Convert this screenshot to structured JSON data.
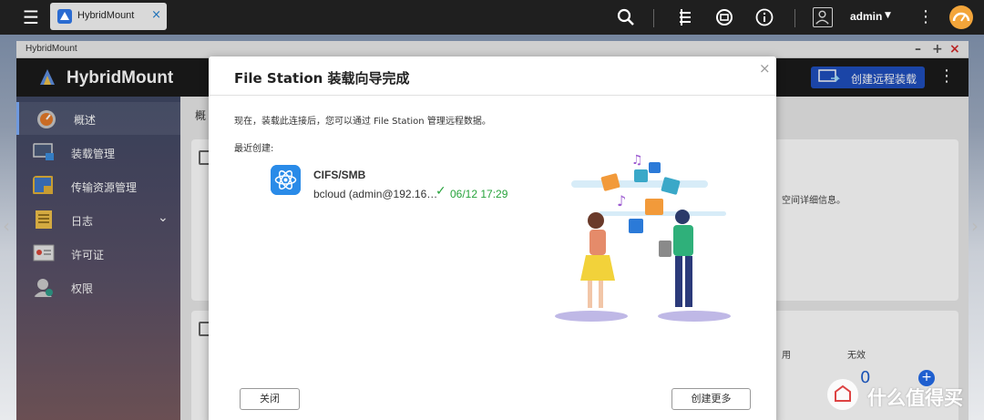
{
  "taskbar": {
    "tab_label": "HybridMount",
    "tab_close": "×",
    "user": "admin",
    "menu_icon": "hamburger-icon",
    "icons": [
      "search-icon",
      "stack-icon",
      "sync-icon",
      "info-icon",
      "user-icon",
      "more-icon",
      "gauge-icon"
    ]
  },
  "window": {
    "title": "HybridMount",
    "controls": {
      "minimize": "–",
      "maximize": "+",
      "close": "×"
    }
  },
  "app": {
    "name": "HybridMount",
    "remote_button": "创建远程装载",
    "accent": "#1f4fbf"
  },
  "sidebar": {
    "items": [
      {
        "label": "概述",
        "icon": "dashboard-gauge-icon"
      },
      {
        "label": "装载管理",
        "icon": "monitor-icon"
      },
      {
        "label": "传输资源管理",
        "icon": "transfer-icon"
      },
      {
        "label": "日志",
        "icon": "log-icon"
      },
      {
        "label": "许可证",
        "icon": "license-icon"
      },
      {
        "label": "权限",
        "icon": "user-permission-icon"
      }
    ]
  },
  "content": {
    "breadcrumb": "概",
    "card1_text": "空间详细信息。",
    "card2_col_a": "用",
    "card2_col_b": "无效",
    "card2_value": "0"
  },
  "modal": {
    "title": "File Station 装载向导完成",
    "close": "×",
    "description": "现在，装载此连接后，您可以通过 File Station 管理远程数据。",
    "recent_label": "最近创建:",
    "entry": {
      "type": "CIFS/SMB",
      "host": "bcloud (admin@192.16…",
      "check": "✓",
      "time": "06/12 17:29",
      "status_color": "#26a33b"
    },
    "buttons": {
      "close": "关闭",
      "create_more": "创建更多"
    }
  },
  "watermark": {
    "text": "什么值得买"
  }
}
